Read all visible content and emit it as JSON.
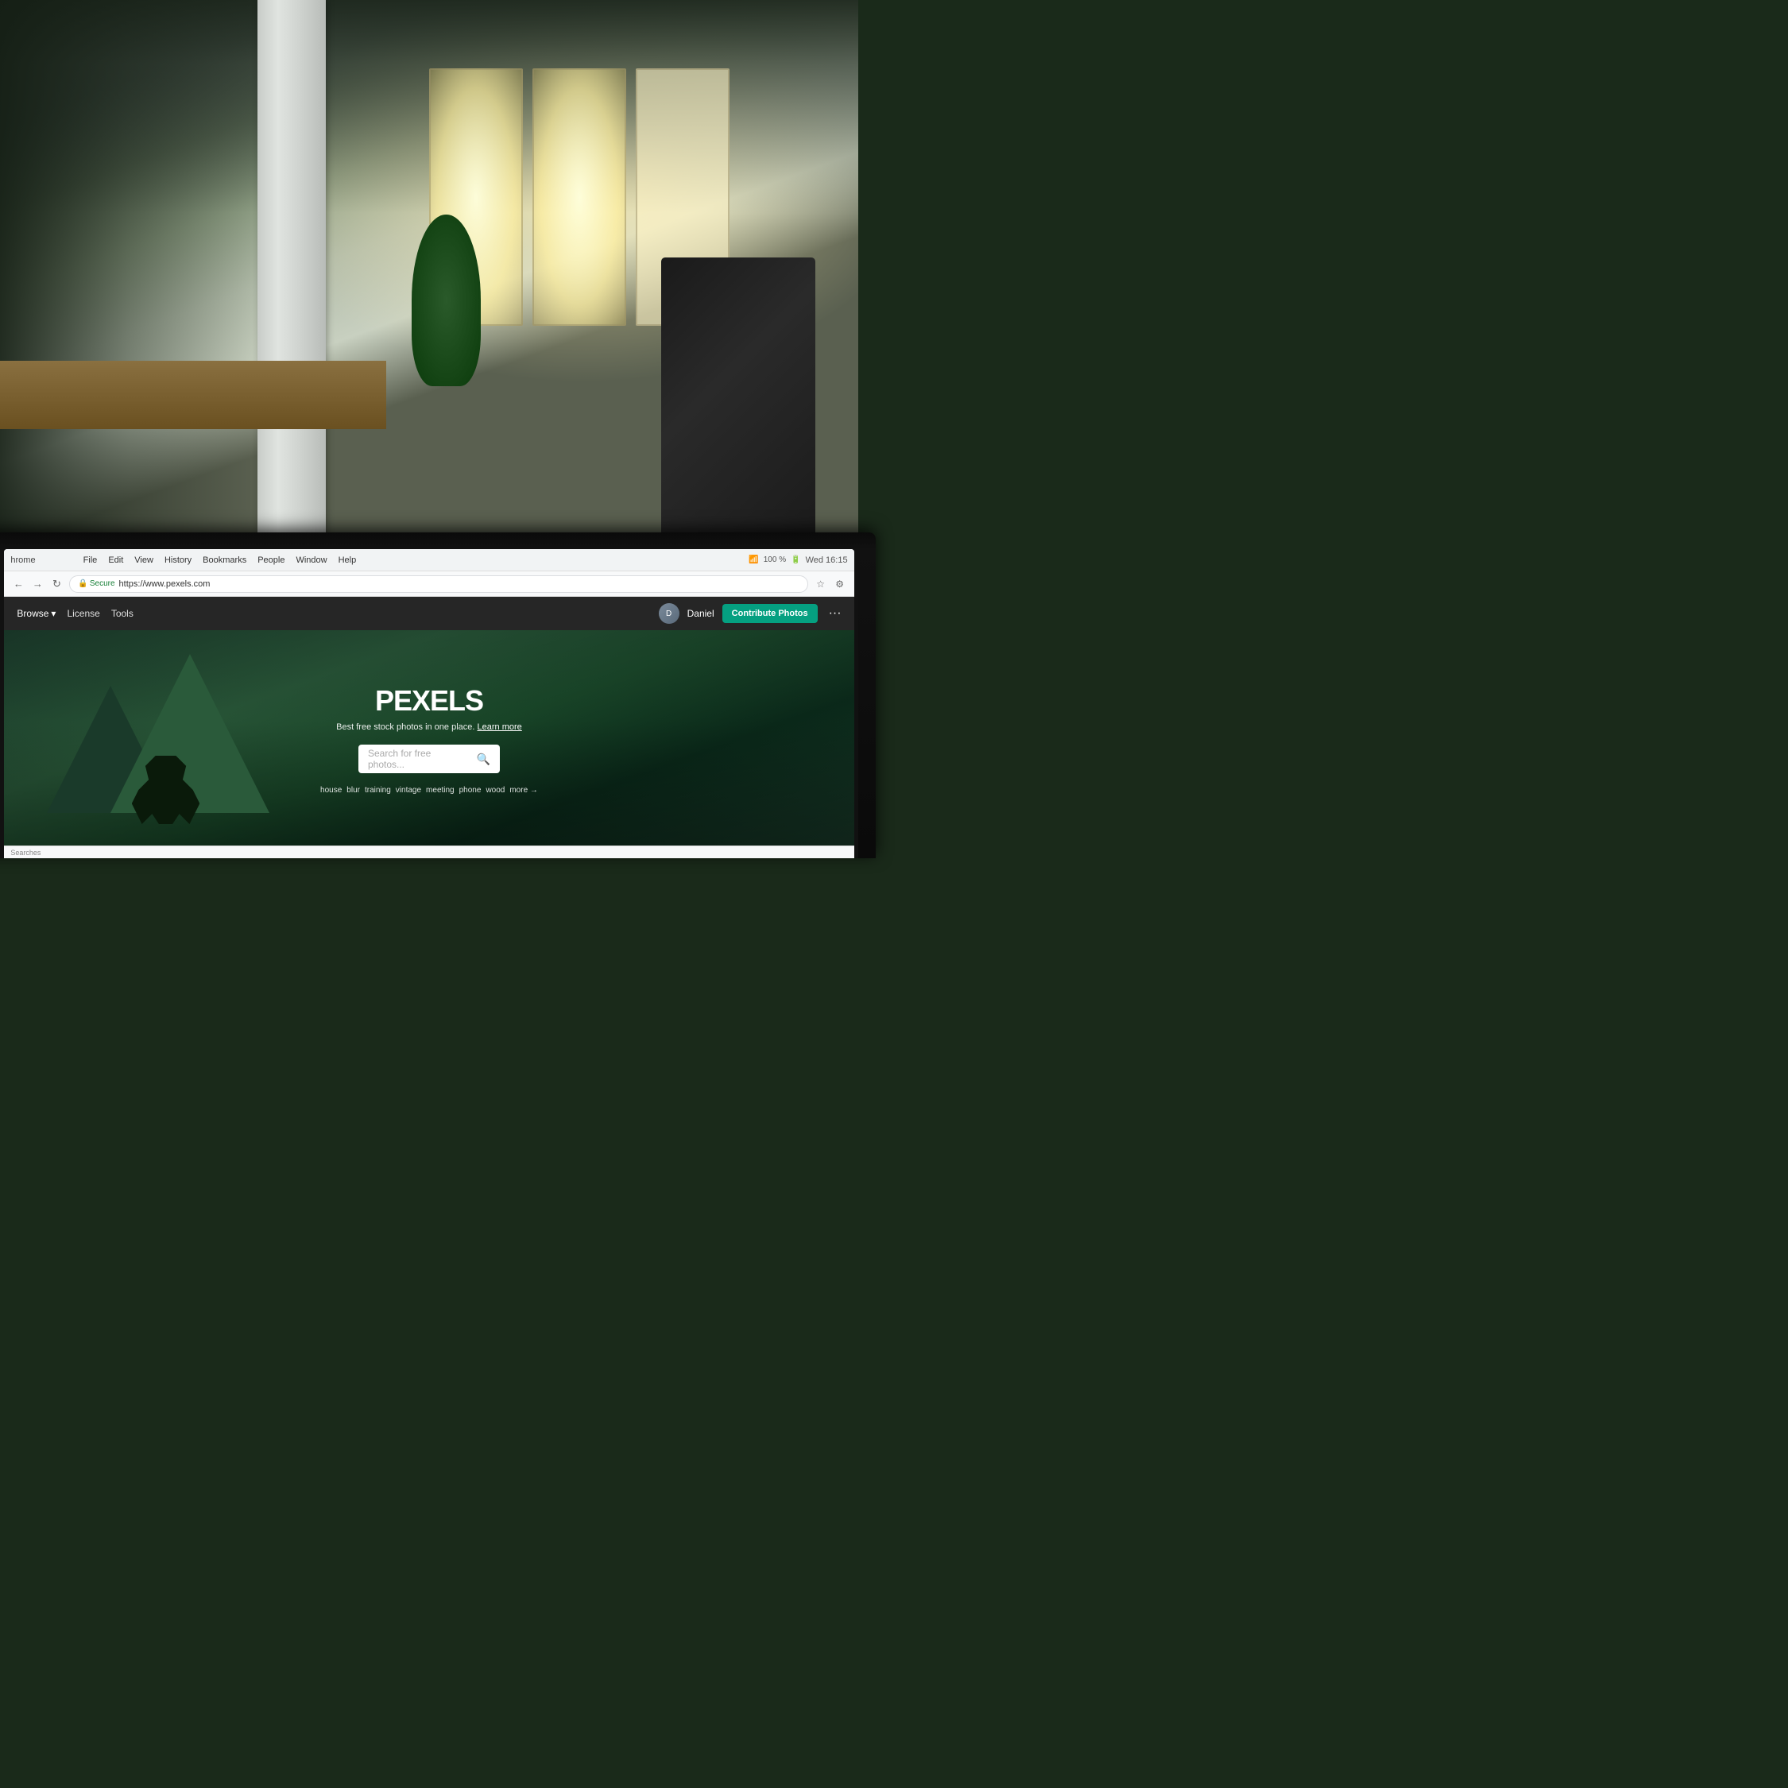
{
  "background": {
    "alt": "Office workspace background with natural light"
  },
  "browser": {
    "menu_items": [
      "File",
      "Edit",
      "View",
      "History",
      "Bookmarks",
      "People",
      "Window",
      "Help"
    ],
    "app_name": "hrome",
    "time": "Wed 16:15",
    "battery": "100 %",
    "secure_label": "Secure",
    "url": "https://www.pexels.com",
    "zoom": "100 %"
  },
  "pexels": {
    "nav": {
      "browse_label": "Browse",
      "license_label": "License",
      "tools_label": "Tools",
      "user_name": "Daniel",
      "contribute_label": "Contribute Photos",
      "more_icon": "···"
    },
    "hero": {
      "logo": "PEXELS",
      "tagline": "Best free stock photos in one place.",
      "learn_more": "Learn more",
      "search_placeholder": "Search for free photos...",
      "tags": [
        "house",
        "blur",
        "training",
        "vintage",
        "meeting",
        "phone",
        "wood"
      ],
      "more_tag": "more →"
    }
  },
  "status_bar": {
    "text": "Searches"
  }
}
